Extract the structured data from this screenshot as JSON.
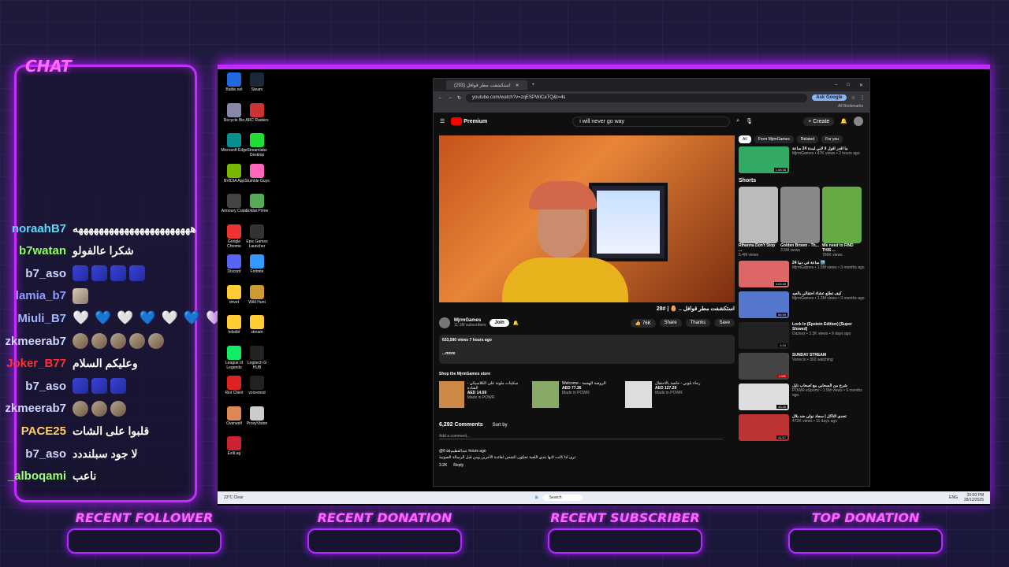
{
  "chat": {
    "title": "CHAT",
    "messages": [
      {
        "user": "noraahB7",
        "color": "#5fd7ff",
        "text": "هههههههههههههههههههههههه",
        "emotes": []
      },
      {
        "user": "b7watan",
        "color": "#8cff5c",
        "text": "شكرا عالفولو",
        "emotes": []
      },
      {
        "user": "b7_aso",
        "color": "#cfd5ff",
        "text": "",
        "emotes": [
          "blue",
          "blue",
          "blue",
          "blue"
        ]
      },
      {
        "user": "lamia_b7",
        "color": "#8f9cff",
        "text": "",
        "emotes": [
          "face"
        ]
      },
      {
        "user": "Miuli_B7",
        "color": "#9fb6ff",
        "text": "",
        "hearts": [
          "🤍",
          "💙",
          "🤍",
          "💙",
          "🤍",
          "💙",
          "🤍"
        ]
      },
      {
        "user": "zkmeerab7",
        "color": "#cfd5ff",
        "text": "",
        "emotes": [
          "tan",
          "tan",
          "tan",
          "tan",
          "tan"
        ]
      },
      {
        "user": "Joker_B77",
        "color": "#ff3030",
        "text": "وعليكم السلام",
        "emotes": []
      },
      {
        "user": "b7_aso",
        "color": "#cfd5ff",
        "text": "",
        "emotes": [
          "blue",
          "blue",
          "blue"
        ]
      },
      {
        "user": "zkmeerab7",
        "color": "#cfd5ff",
        "text": "",
        "emotes": [
          "tan",
          "tan",
          "tan"
        ]
      },
      {
        "user": "PACE25",
        "color": "#ffcc66",
        "text": "قلبوا على الشات",
        "emotes": []
      },
      {
        "user": "b7_aso",
        "color": "#cfd5ff",
        "text": "لا جود سبلنددد",
        "emotes": []
      },
      {
        "user": "_alboqami",
        "color": "#9dff7a",
        "text": "ناعب",
        "emotes": []
      }
    ]
  },
  "desktop": {
    "icons": [
      "Battle.net",
      "Steam",
      "Recycle Bin",
      "ARC Raiders",
      "Microsoft Edge",
      "Streamlabs Desktop",
      "NVIDIA App",
      "Stumble Guys",
      "Armoury Crate",
      "Soldat Prime",
      "Google Chrome",
      "Epic Games Launcher",
      "Discord",
      "Fortnite",
      "drivet",
      "Wild Hunt",
      "hdsdbf",
      "stream",
      "League of Legends",
      "Logitech G HUB",
      "Riot Client",
      "voicemod",
      "Overwolf",
      "ProxyVision",
      "ExitLag"
    ]
  },
  "browser": {
    "tab_title": "استكشفت مطر قوافل (293)",
    "url": "youtube.com/watch?v=zqESPWiCaTQ&t=4s",
    "ask_google": "Ask Google",
    "all_bookmarks": "All Bookmarks",
    "youtube": {
      "logo": "Premium",
      "search_value": "i will never go way",
      "create": "Create",
      "video_title": "استكشفت مطر قوافل .. 🥚 | #28",
      "channel": "MjrmGames",
      "subscribers": "11.1M subscribers",
      "join": "Join",
      "likes": "76K",
      "share": "Share",
      "thanks": "Thanks",
      "save": "Save",
      "views": "633,590 views 7 hours ago",
      "desc_more": "...more",
      "store_title": "Shop the MjrmGames store",
      "store_items": [
        {
          "name": "سكيتات ملونة على الكلاسيكي - الشادة",
          "price": "AED 14.69",
          "by": "Made in POWR"
        },
        {
          "name": "Welcome - الروضة الهجمة",
          "price": "AED 77.36",
          "by": "Made in POWR"
        },
        {
          "name": "رجاء بلوني - خاصة بالاحتفال",
          "price": "AED 127.29",
          "by": "Made in POWR"
        }
      ],
      "comments_count": "6,292 Comments",
      "sort_by": "Sort by",
      "add_comment": "Add a comment...",
      "top_comment_user": "@عبدالعظيم٥٥ 6 hours ago",
      "top_comment": "ترى اذا كانت لانها بتدي اللعبة تحكون الشحن لفائدة الأخرين ومن قبل الرسالة الصوتية",
      "comment_likes": "3.2K",
      "reply": "Reply",
      "chips": [
        "All",
        "From MjrmGames",
        "Related",
        "For you"
      ],
      "shorts_label": "Shorts",
      "shorts": [
        {
          "title": "Rihanna Don't Stop ...",
          "views": "5.4M views"
        },
        {
          "title": "Golden Brown - Th...",
          "views": "3.5M views"
        },
        {
          "title": "We need to FIND THIS ...",
          "views": "766K views"
        }
      ],
      "related": [
        {
          "title": "ما اقدر اقول لا لابي لمدة 24 ساعة",
          "meta": "MjrmGames • 47K views • 2 hours ago",
          "badge": "1:08:36"
        },
        {
          "title": "24 ساعة في دبيا 🏙️",
          "meta": "MjrmGames • 1.5M views • 3 months ago",
          "badge": "3:03:45"
        },
        {
          "title": "كيف تطلع عشاء احتفالي بالعيد",
          "meta": "MjrmGames • 1.3M views • 3 months ago",
          "badge": "55:59"
        },
        {
          "title": "Lock In (Epstein Edition) [Super Slowed]",
          "meta": "Dazexx • 3.3K views • 9 days ago",
          "badge": "2:24"
        },
        {
          "title": "SUNDAY STREAM",
          "meta": "Vanecio • 363 watching",
          "badge": "LIVE"
        },
        {
          "title": "شرح من السحابي مع اصحاب نايل",
          "meta": "POWR eSports • 1.5M views • 9 months ago",
          "badge": "45:45"
        },
        {
          "title": "تحدي التاكل | سجاد نولي ضد بلال",
          "meta": "472K views • 11 days ago",
          "badge": "41:57"
        }
      ]
    }
  },
  "taskbar": {
    "weather": "23°C Clear",
    "search": "Search",
    "lang": "ENG",
    "time": "20:00 PM",
    "date": "28/12/2025"
  },
  "widgets": [
    "RECENT FOLLOWER",
    "RECENT DONATION",
    "RECENT SUBSCRIBER",
    "TOP DONATION"
  ]
}
